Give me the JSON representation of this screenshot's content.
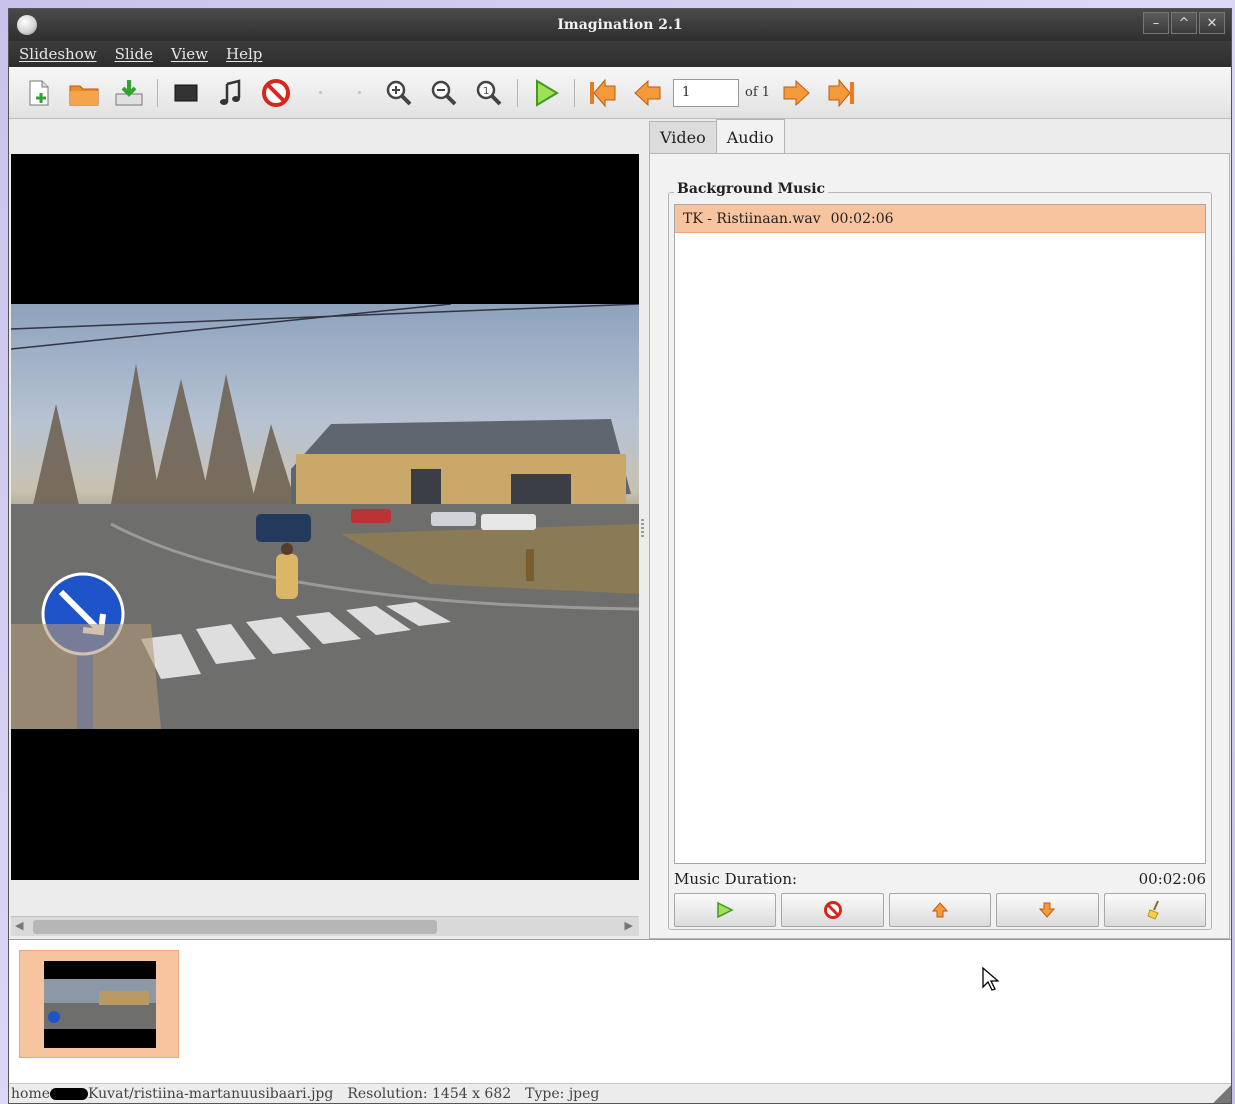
{
  "window": {
    "title": "Imagination 2.1"
  },
  "menubar": {
    "items": [
      "Slideshow",
      "Slide",
      "View",
      "Help"
    ]
  },
  "toolbar": {
    "current_slide": "1",
    "of_label": "of 1"
  },
  "tabs": [
    "Video",
    "Audio"
  ],
  "audio": {
    "group_label": "Background Music",
    "tracks": [
      {
        "name": "TK - Ristiinaan.wav",
        "duration": "00:02:06"
      }
    ],
    "duration_label": "Music Duration:",
    "duration_value": "00:02:06"
  },
  "statusbar": {
    "path_prefix": "home",
    "path_suffix": "Kuvat/ristiina-martanuusibaari.jpg",
    "resolution": "Resolution: 1454 x 682",
    "type": "Type: jpeg"
  },
  "colors": {
    "selection": "#f8c49f",
    "titlebar": "#3a3a3a",
    "accent_orange": "#f07a1a"
  }
}
